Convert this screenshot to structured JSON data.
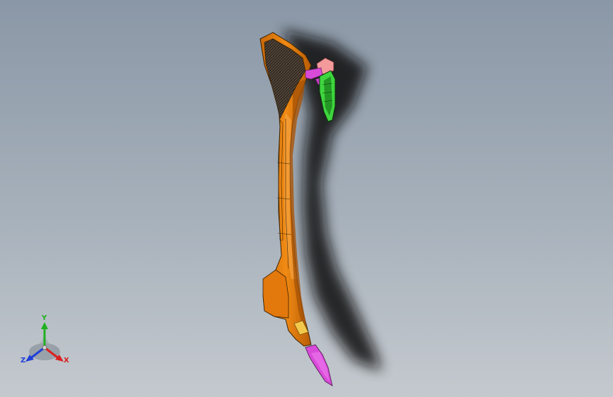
{
  "viewport": {
    "background_top": "#8a97a6",
    "background_bottom": "#c4c9ce"
  },
  "model": {
    "name": "",
    "body_color": "#e9800e",
    "mesh_color": "#3a3028",
    "tip_color": "#d84bd8",
    "bracket_color": "#3fd63f",
    "knob_color": "#f49a9a",
    "band_color": "#f2c84a"
  },
  "triad": {
    "x_label": "X",
    "y_label": "Y",
    "z_label": "Z",
    "x_color": "#d92020",
    "y_color": "#20b020",
    "z_color": "#2040d8"
  }
}
